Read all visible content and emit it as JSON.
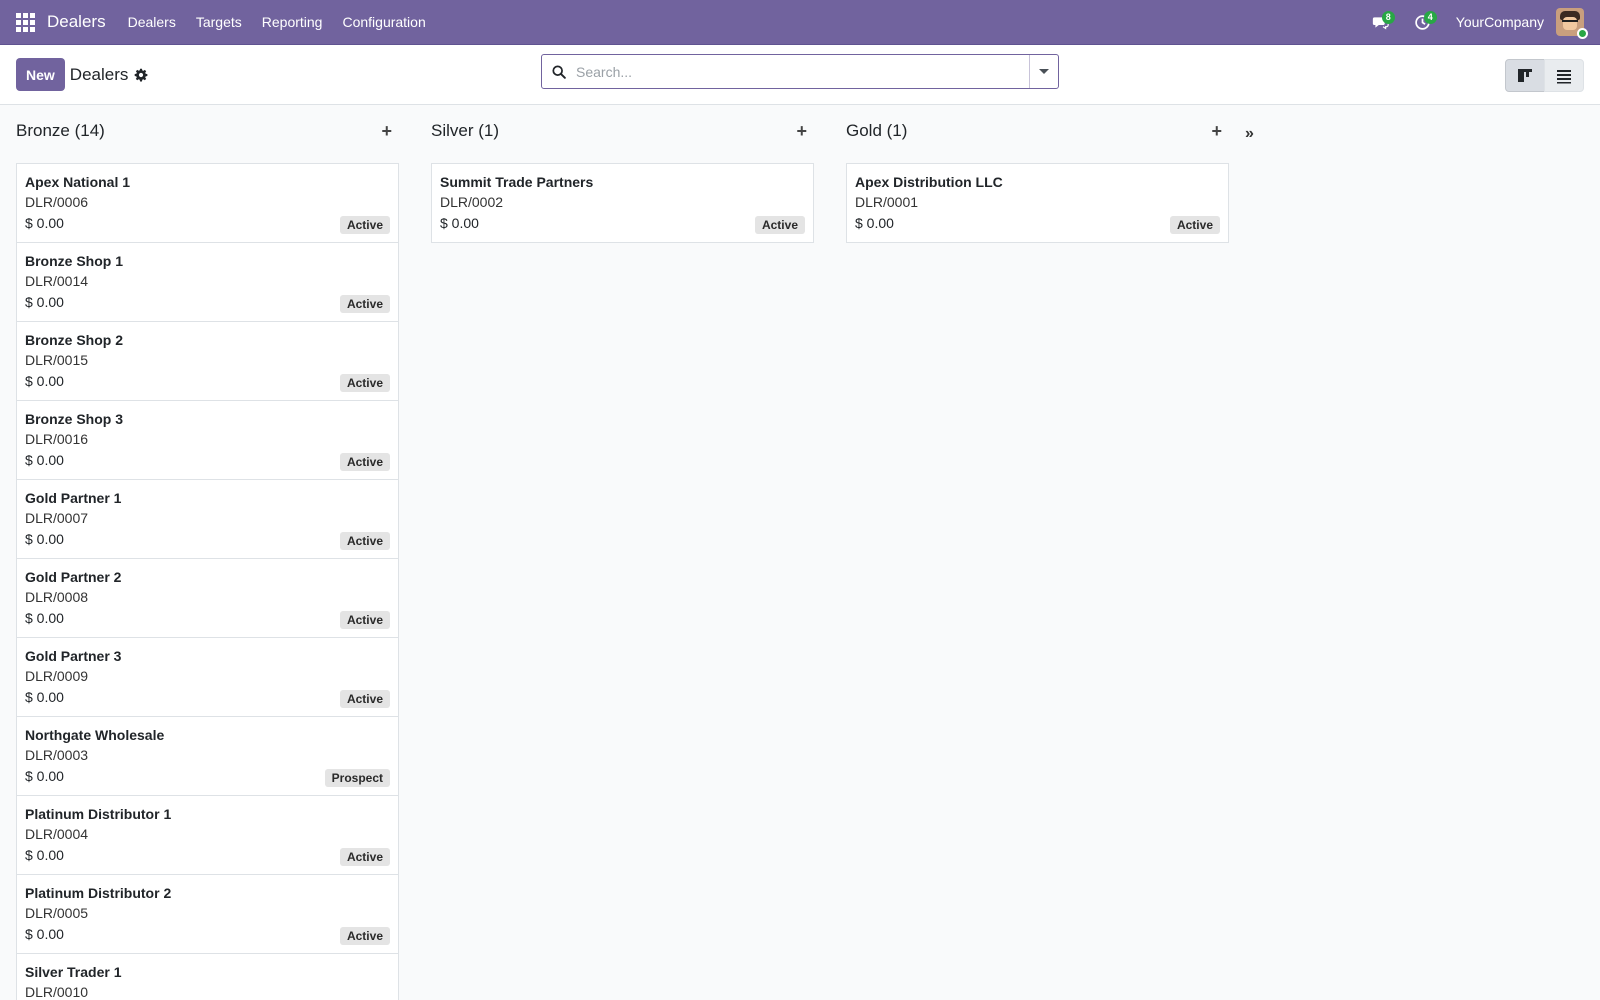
{
  "navbar": {
    "brand": "Dealers",
    "menu": [
      "Dealers",
      "Targets",
      "Reporting",
      "Configuration"
    ],
    "messages_count": "8",
    "activities_count": "4",
    "company": "YourCompany"
  },
  "control": {
    "new_label": "New",
    "title": "Dealers",
    "search_placeholder": "Search..."
  },
  "columns": [
    {
      "title": "Bronze (14)",
      "cards": [
        {
          "name": "Apex National 1",
          "ref": "DLR/0006",
          "amount": "$ 0.00",
          "status": "Active"
        },
        {
          "name": "Bronze Shop 1",
          "ref": "DLR/0014",
          "amount": "$ 0.00",
          "status": "Active"
        },
        {
          "name": "Bronze Shop 2",
          "ref": "DLR/0015",
          "amount": "$ 0.00",
          "status": "Active"
        },
        {
          "name": "Bronze Shop 3",
          "ref": "DLR/0016",
          "amount": "$ 0.00",
          "status": "Active"
        },
        {
          "name": "Gold Partner 1",
          "ref": "DLR/0007",
          "amount": "$ 0.00",
          "status": "Active"
        },
        {
          "name": "Gold Partner 2",
          "ref": "DLR/0008",
          "amount": "$ 0.00",
          "status": "Active"
        },
        {
          "name": "Gold Partner 3",
          "ref": "DLR/0009",
          "amount": "$ 0.00",
          "status": "Active"
        },
        {
          "name": "Northgate Wholesale",
          "ref": "DLR/0003",
          "amount": "$ 0.00",
          "status": "Prospect"
        },
        {
          "name": "Platinum Distributor 1",
          "ref": "DLR/0004",
          "amount": "$ 0.00",
          "status": "Active"
        },
        {
          "name": "Platinum Distributor 2",
          "ref": "DLR/0005",
          "amount": "$ 0.00",
          "status": "Active"
        },
        {
          "name": "Silver Trader 1",
          "ref": "DLR/0010",
          "amount": "",
          "status": ""
        }
      ]
    },
    {
      "title": "Silver (1)",
      "cards": [
        {
          "name": "Summit Trade Partners",
          "ref": "DLR/0002",
          "amount": "$ 0.00",
          "status": "Active"
        }
      ]
    },
    {
      "title": "Gold (1)",
      "cards": [
        {
          "name": "Apex Distribution LLC",
          "ref": "DLR/0001",
          "amount": "$ 0.00",
          "status": "Active"
        }
      ]
    }
  ]
}
